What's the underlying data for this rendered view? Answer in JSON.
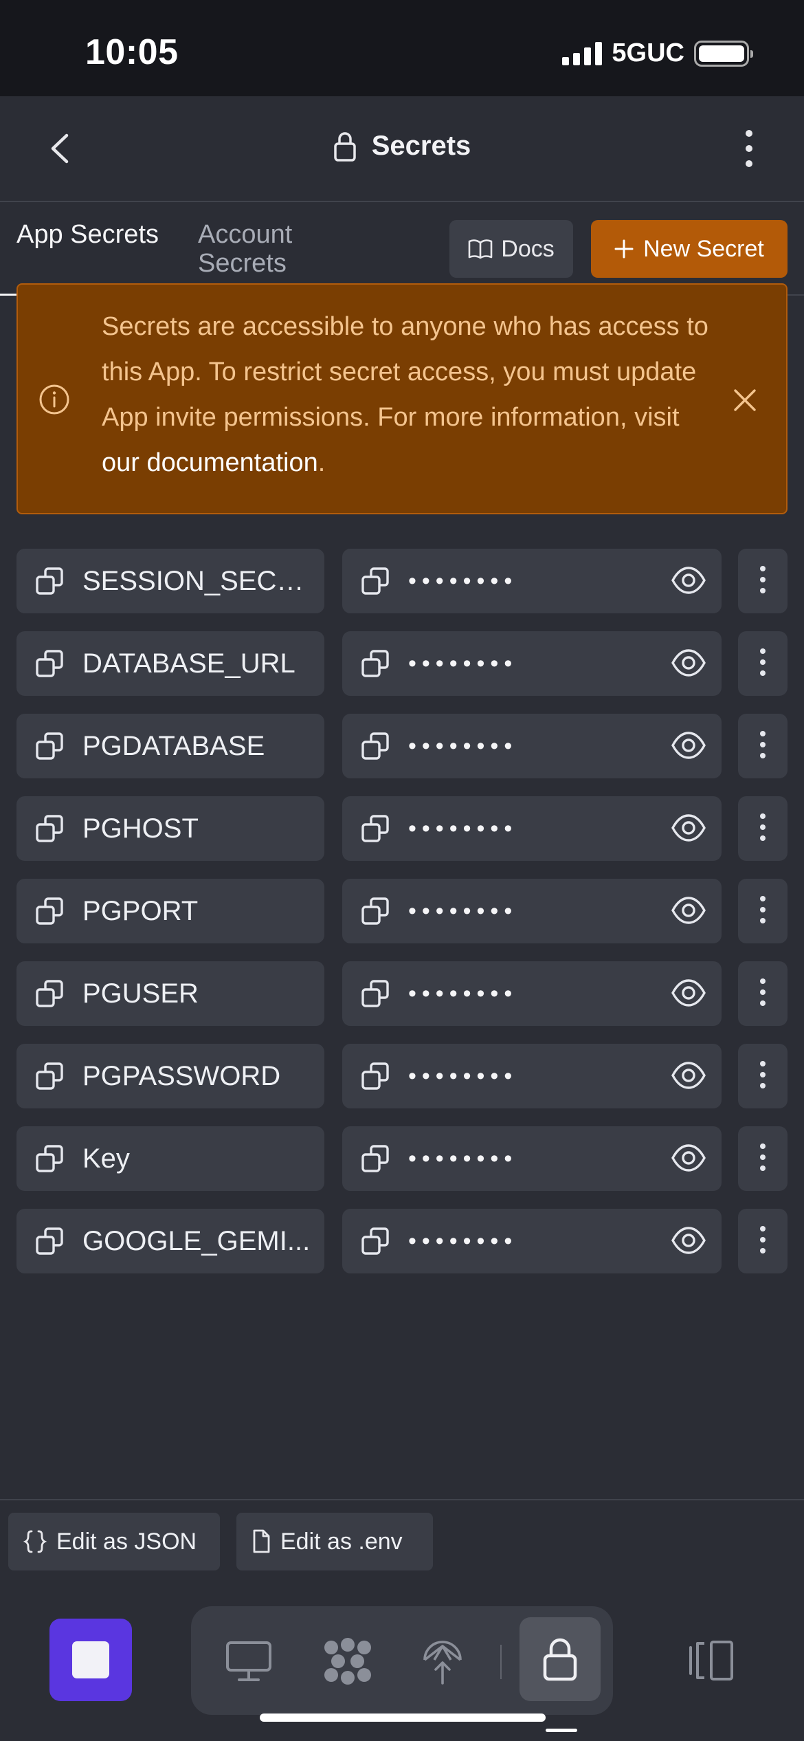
{
  "status_bar": {
    "time": "10:05",
    "network": "5GUC"
  },
  "header": {
    "title": "Secrets"
  },
  "tabs": {
    "app": "App Secrets",
    "account": "Account Secrets"
  },
  "actions": {
    "docs": "Docs",
    "new_secret": "New Secret"
  },
  "banner": {
    "text": "Secrets are accessible to anyone who has access to this App. To restrict secret access, you must update App invite permissions. For more information, visit ",
    "link": "our documentation",
    "end": "."
  },
  "secrets": [
    {
      "key": "SESSION_SECR...",
      "value": "••••••••"
    },
    {
      "key": "DATABASE_URL",
      "value": "••••••••"
    },
    {
      "key": "PGDATABASE",
      "value": "••••••••"
    },
    {
      "key": "PGHOST",
      "value": "••••••••"
    },
    {
      "key": "PGPORT",
      "value": "••••••••"
    },
    {
      "key": "PGUSER",
      "value": "••••••••"
    },
    {
      "key": "PGPASSWORD",
      "value": "••••••••"
    },
    {
      "key": "Key",
      "value": "••••••••"
    },
    {
      "key": "GOOGLE_GEMI...",
      "value": "••••••••"
    }
  ],
  "edit": {
    "json": "Edit as JSON",
    "env": "Edit as .env"
  },
  "colors": {
    "accent_orange": "#b35a08",
    "banner_bg": "#7a3e02",
    "stop_purple": "#5a36e0",
    "background": "#2b2d35"
  },
  "icons": [
    "back-chevron-icon",
    "lock-icon",
    "more-vertical-icon",
    "book-icon",
    "plus-icon",
    "info-icon",
    "close-icon",
    "copy-icon",
    "eye-icon",
    "braces-icon",
    "file-icon",
    "stop-icon",
    "monitor-icon",
    "workflow-icon",
    "deploy-icon",
    "panels-icon"
  ]
}
